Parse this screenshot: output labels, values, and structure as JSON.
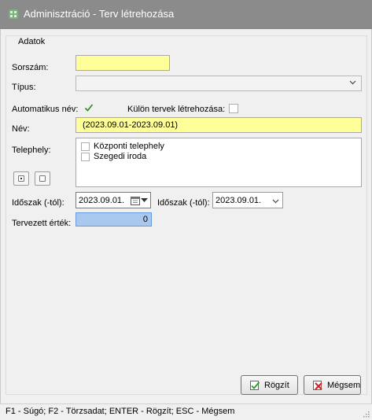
{
  "window": {
    "title": "Adminisztráció - Terv létrehozása"
  },
  "group": {
    "title": "Adatok"
  },
  "form": {
    "sorszam_label": "Sorszám:",
    "sorszam_value": "",
    "tipus_label": "Típus:",
    "tipus_value": "",
    "auto_name_label": "Automatikus név:",
    "auto_name_checked": true,
    "separate_plans_label": "Külön tervek létrehozása:",
    "separate_plans_checked": false,
    "nev_label": "Név:",
    "nev_value": "(2023.09.01-2023.09.01)",
    "telephely_label": "Telephely:",
    "telephely_items": [
      {
        "label": "Központi telephely",
        "checked": false
      },
      {
        "label": "Szegedi iroda",
        "checked": false
      }
    ],
    "idoszak_from_label": "Időszak (-tól):",
    "idoszak_from_value": "2023.09.01.",
    "idoszak_to_label": "Időszak (-tól):",
    "idoszak_to_value": "2023.09.01.",
    "tervezett_label": "Tervezett érték:",
    "tervezett_value": "0"
  },
  "buttons": {
    "save": "Rögzít",
    "cancel": "Mégsem"
  },
  "status": {
    "text": "F1 - Súgó; F2 - Törzsadat; ENTER - Rögzít; ESC - Mégsem"
  },
  "colors": {
    "required_field": "#ffff99",
    "numeric_field": "#a8c8ee",
    "titlebar": "#8b8b8b"
  }
}
